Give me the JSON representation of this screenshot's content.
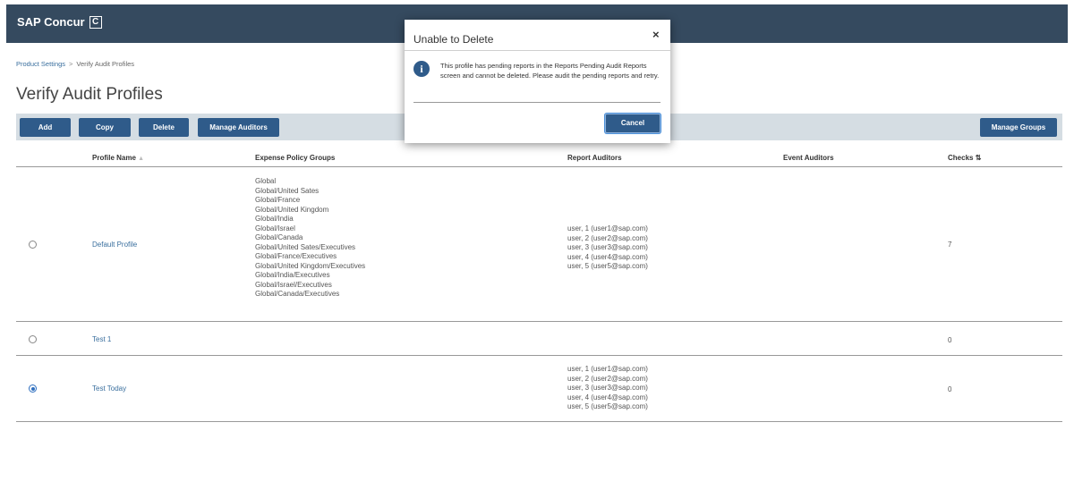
{
  "header": {
    "brand": "SAP Concur",
    "brand_mark": "C"
  },
  "breadcrumb": {
    "parent": "Product Settings",
    "separator": ">",
    "current": "Verify Audit Profiles"
  },
  "page_title": "Verify Audit Profiles",
  "toolbar": {
    "add_label": "Add",
    "copy_label": "Copy",
    "delete_label": "Delete",
    "manage_auditors_label": "Manage Auditors",
    "manage_groups_label": "Manage Groups"
  },
  "table": {
    "columns": {
      "profile_name": "Profile Name",
      "profile_name_sort": "▲",
      "expense_policy_groups": "Expense Policy Groups",
      "report_auditors": "Report Auditors",
      "event_auditors": "Event Auditors",
      "checks": "Checks",
      "checks_sort": "⇅"
    },
    "rows": [
      {
        "selected": false,
        "name": "Default Profile",
        "groups": [
          "Global",
          "Global/United Sates",
          "Global/France",
          "Global/United Kingdom",
          "Global/India",
          "Global/Israel",
          "Global/Canada",
          "Global/United Sates/Executives",
          "Global/France/Executives",
          "Global/United Kingdom/Executives",
          "Global/India/Executives",
          "Global/Israel/Executives",
          "Global/Canada/Executives"
        ],
        "auditors": [
          "user, 1 (user1@sap.com)",
          "user, 2 (user2@sap.com)",
          "user, 3 (user3@sap.com)",
          "user, 4 (user4@sap.com)",
          "user, 5 (user5@sap.com)"
        ],
        "checks": "7"
      },
      {
        "selected": false,
        "name": "Test 1",
        "groups": [],
        "auditors": [],
        "checks": "0"
      },
      {
        "selected": true,
        "name": "Test Today",
        "groups": [],
        "auditors": [
          "user, 1 (user1@sap.com)",
          "user, 2 (user2@sap.com)",
          "user, 3 (user3@sap.com)",
          "user, 4 (user4@sap.com)",
          "user, 5 (user5@sap.com)"
        ],
        "checks": "0"
      }
    ]
  },
  "modal": {
    "title": "Unable to Delete",
    "close_glyph": "×",
    "info_glyph": "i",
    "message": "This profile has pending reports in the Reports Pending Audit Reports screen and cannot be deleted. Please audit the pending reports and retry.",
    "cancel_label": "Cancel"
  },
  "colors": {
    "header_bg": "#354a5f",
    "button_bg": "#2f5b8a",
    "toolbar_bg": "#d5dde3",
    "link": "#3a6f9e",
    "radio_selected": "#2f6fbf"
  }
}
